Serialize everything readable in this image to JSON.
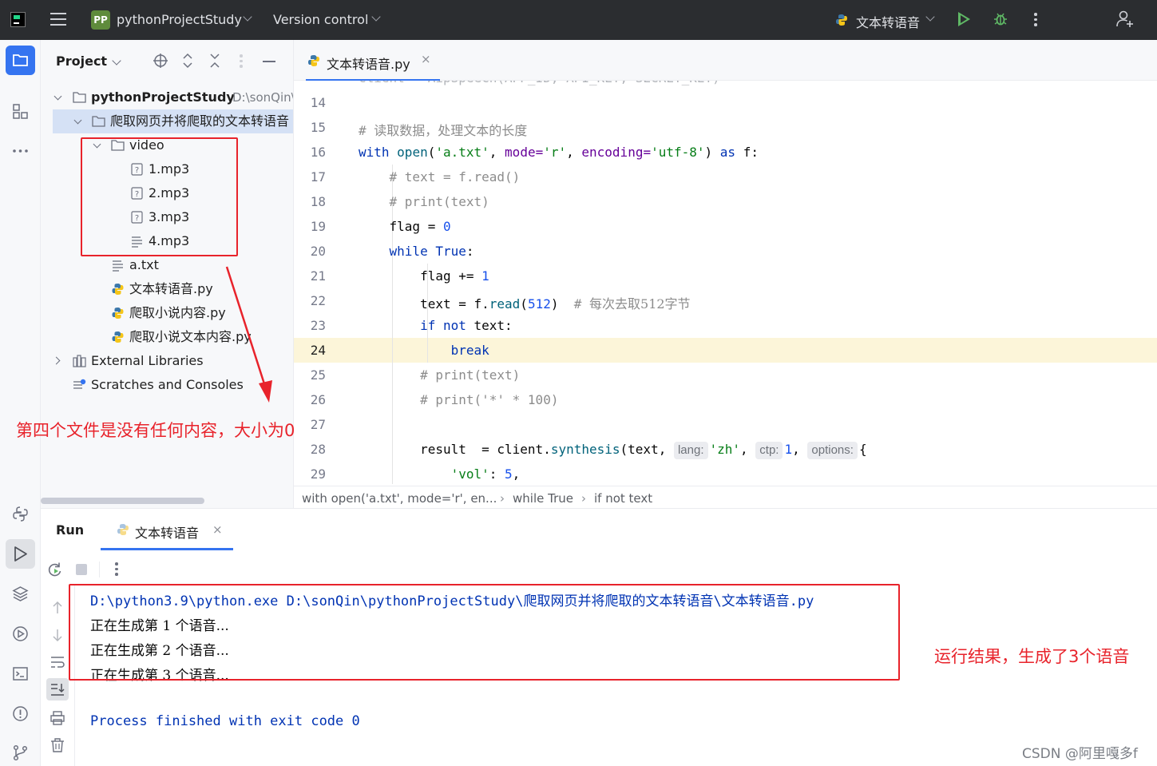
{
  "titlebar": {
    "project_badge": "PP",
    "project_name": "pythonProjectStudy",
    "vcs_label": "Version control",
    "run_config": "文本转语音"
  },
  "project_panel": {
    "header": "Project",
    "tree": {
      "root_name": "pythonProjectStudy",
      "root_path": "D:\\sonQin\\",
      "folder": "爬取网页并将爬取的文本转语音",
      "video_folder": "video",
      "files_video": [
        "1.mp3",
        "2.mp3",
        "3.mp3",
        "4.mp3"
      ],
      "a_txt": "a.txt",
      "py_files": [
        "文本转语音.py",
        "爬取小说内容.py",
        "爬取小说文本内容.py"
      ],
      "external_libraries": "External Libraries",
      "scratches": "Scratches and Consoles"
    }
  },
  "editor": {
    "tab_label": "文本转语音.py",
    "tab_close": "×",
    "line_numbers": [
      "14",
      "15",
      "16",
      "17",
      "18",
      "19",
      "20",
      "21",
      "22",
      "23",
      "24",
      "25",
      "26",
      "27",
      "28",
      "29"
    ],
    "highlighted_line": "24",
    "breadcrumbs": [
      "with open('a.txt', mode='r', en...",
      "while True",
      "if not text"
    ],
    "inlay_hints": {
      "lang": "lang:",
      "ctp": "ctp:",
      "options": "options:"
    }
  },
  "run_panel": {
    "title": "Run",
    "tab_label": "文本转语音",
    "tab_close": "×",
    "console": {
      "command": "D:\\python3.9\\python.exe D:\\sonQin\\pythonProjectStudy\\爬取网页并将爬取的文本转语音\\文本转语音.py",
      "outputs": [
        "正在生成第 1 个语音...",
        "正在生成第 2 个语音...",
        "正在生成第 3 个语音..."
      ],
      "finish": "Process finished with exit code 0"
    }
  },
  "annotations": {
    "left_note": "第四个文件是没有任何内容，大小为0",
    "right_note": "运行结果，生成了3个语音",
    "color": "#e8232b"
  },
  "watermark": "CSDN @阿里嘎多f",
  "colors": {
    "titlebar_bg": "#2b2d30",
    "accent": "#3574f0",
    "selection": "#d5e1f5",
    "current_line": "#fcf5d9",
    "run_green": "#5fb865"
  }
}
